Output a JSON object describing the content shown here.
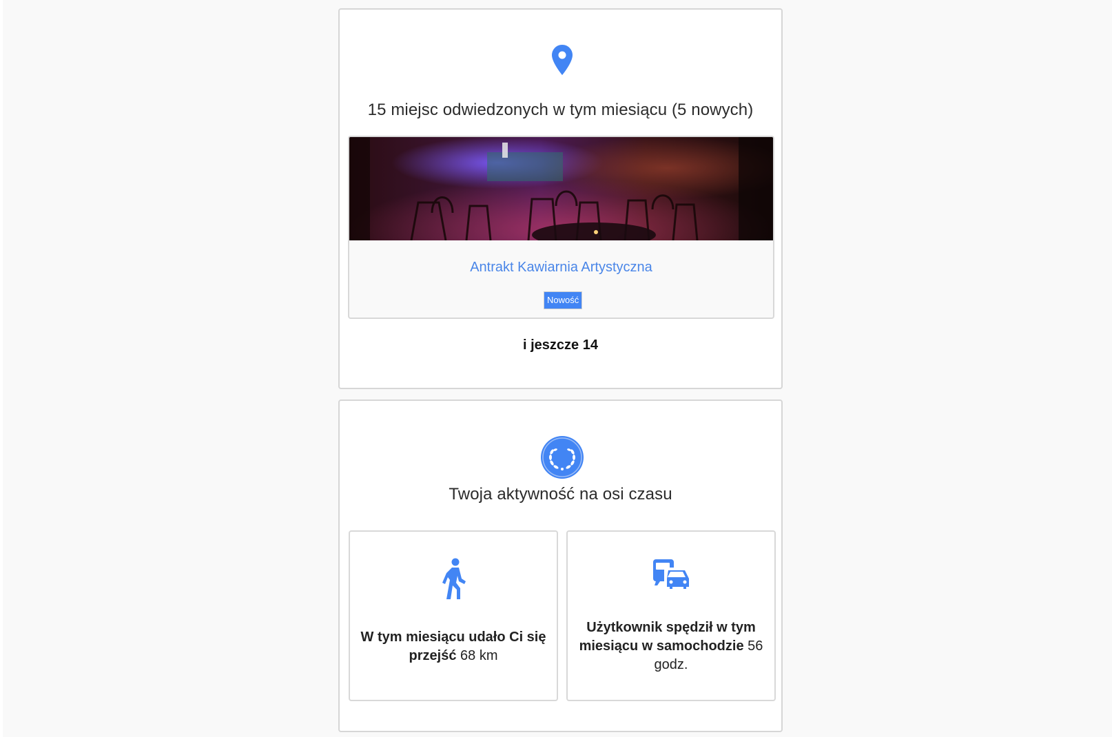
{
  "places": {
    "title": "15 miejsc odwiedzonych w tym miesiącu (5 nowych)",
    "pin_icon": "map-pin-icon",
    "accent": "#4285f4",
    "featured": {
      "name": "Antrakt Kawiarnia Artystyczna",
      "badge": "Nowość"
    },
    "more": "i jeszcze 14"
  },
  "activity": {
    "title": "Twoja aktywność na osi czasu",
    "badge_icon": "laurel-wreath-icon",
    "walk": {
      "icon": "walking-person-icon",
      "label": "W tym miesiącu udało Ci się przejść",
      "value": "68 km"
    },
    "drive": {
      "icon": "car-and-bus-icon",
      "label": "Użytkownik spędził w tym miesiącu w samochodzie",
      "value": "56 godz."
    }
  }
}
